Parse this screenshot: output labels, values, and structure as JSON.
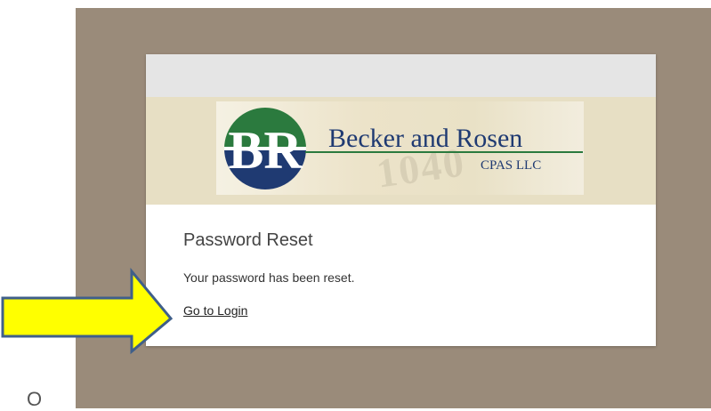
{
  "page": {
    "corner_glyph": "O"
  },
  "banner": {
    "logo_initials": "BR",
    "company_name": "Becker and Rosen",
    "company_suffix": "CPAS LLC",
    "watermark_text": "1040"
  },
  "content": {
    "title": "Password Reset",
    "message": "Your password has been reset.",
    "login_link": "Go to Login"
  },
  "colors": {
    "backdrop": "#9a8b7a",
    "topbar": "#e5e5e5",
    "banner": "#e7dfc4",
    "logo_green": "#2b7a3e",
    "logo_navy": "#1f3a72",
    "arrow_fill": "#ffff00",
    "arrow_stroke": "#3f5f8a"
  },
  "icons": {
    "pointer_arrow": "arrow-right-icon"
  }
}
